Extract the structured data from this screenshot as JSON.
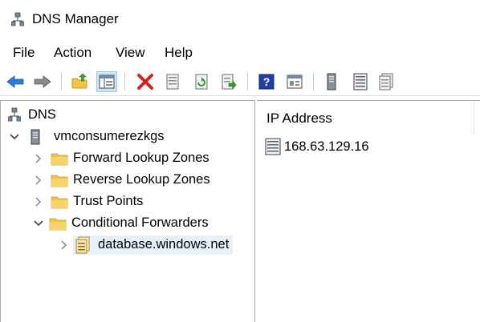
{
  "window": {
    "title": "DNS Manager"
  },
  "menu": {
    "items": [
      "File",
      "Action",
      "View",
      "Help"
    ]
  },
  "toolbar": {
    "buttons": [
      "back-arrow-icon",
      "forward-arrow-icon",
      "up-folder-icon",
      "show-hide-tree-icon",
      "delete-icon",
      "properties-icon",
      "refresh-icon",
      "export-list-icon",
      "help-icon",
      "console-icon",
      "server-icon",
      "list-icon",
      "records-icon"
    ]
  },
  "tree": {
    "root": "DNS",
    "server": "vmconsumerezkgs",
    "forward_zones": "Forward Lookup Zones",
    "reverse_zones": "Reverse Lookup Zones",
    "trust_points": "Trust Points",
    "conditional_forwarders": "Conditional Forwarders",
    "selected_item": "database.windows.net"
  },
  "list": {
    "column_header": "IP Address",
    "rows": [
      {
        "ip": "168.63.129.16"
      }
    ]
  },
  "colors": {
    "selection": "#e5f1fb",
    "toolbar_active": "#cce4f7",
    "folder": "#f5c342",
    "arrow_blue": "#2a7fd4"
  }
}
